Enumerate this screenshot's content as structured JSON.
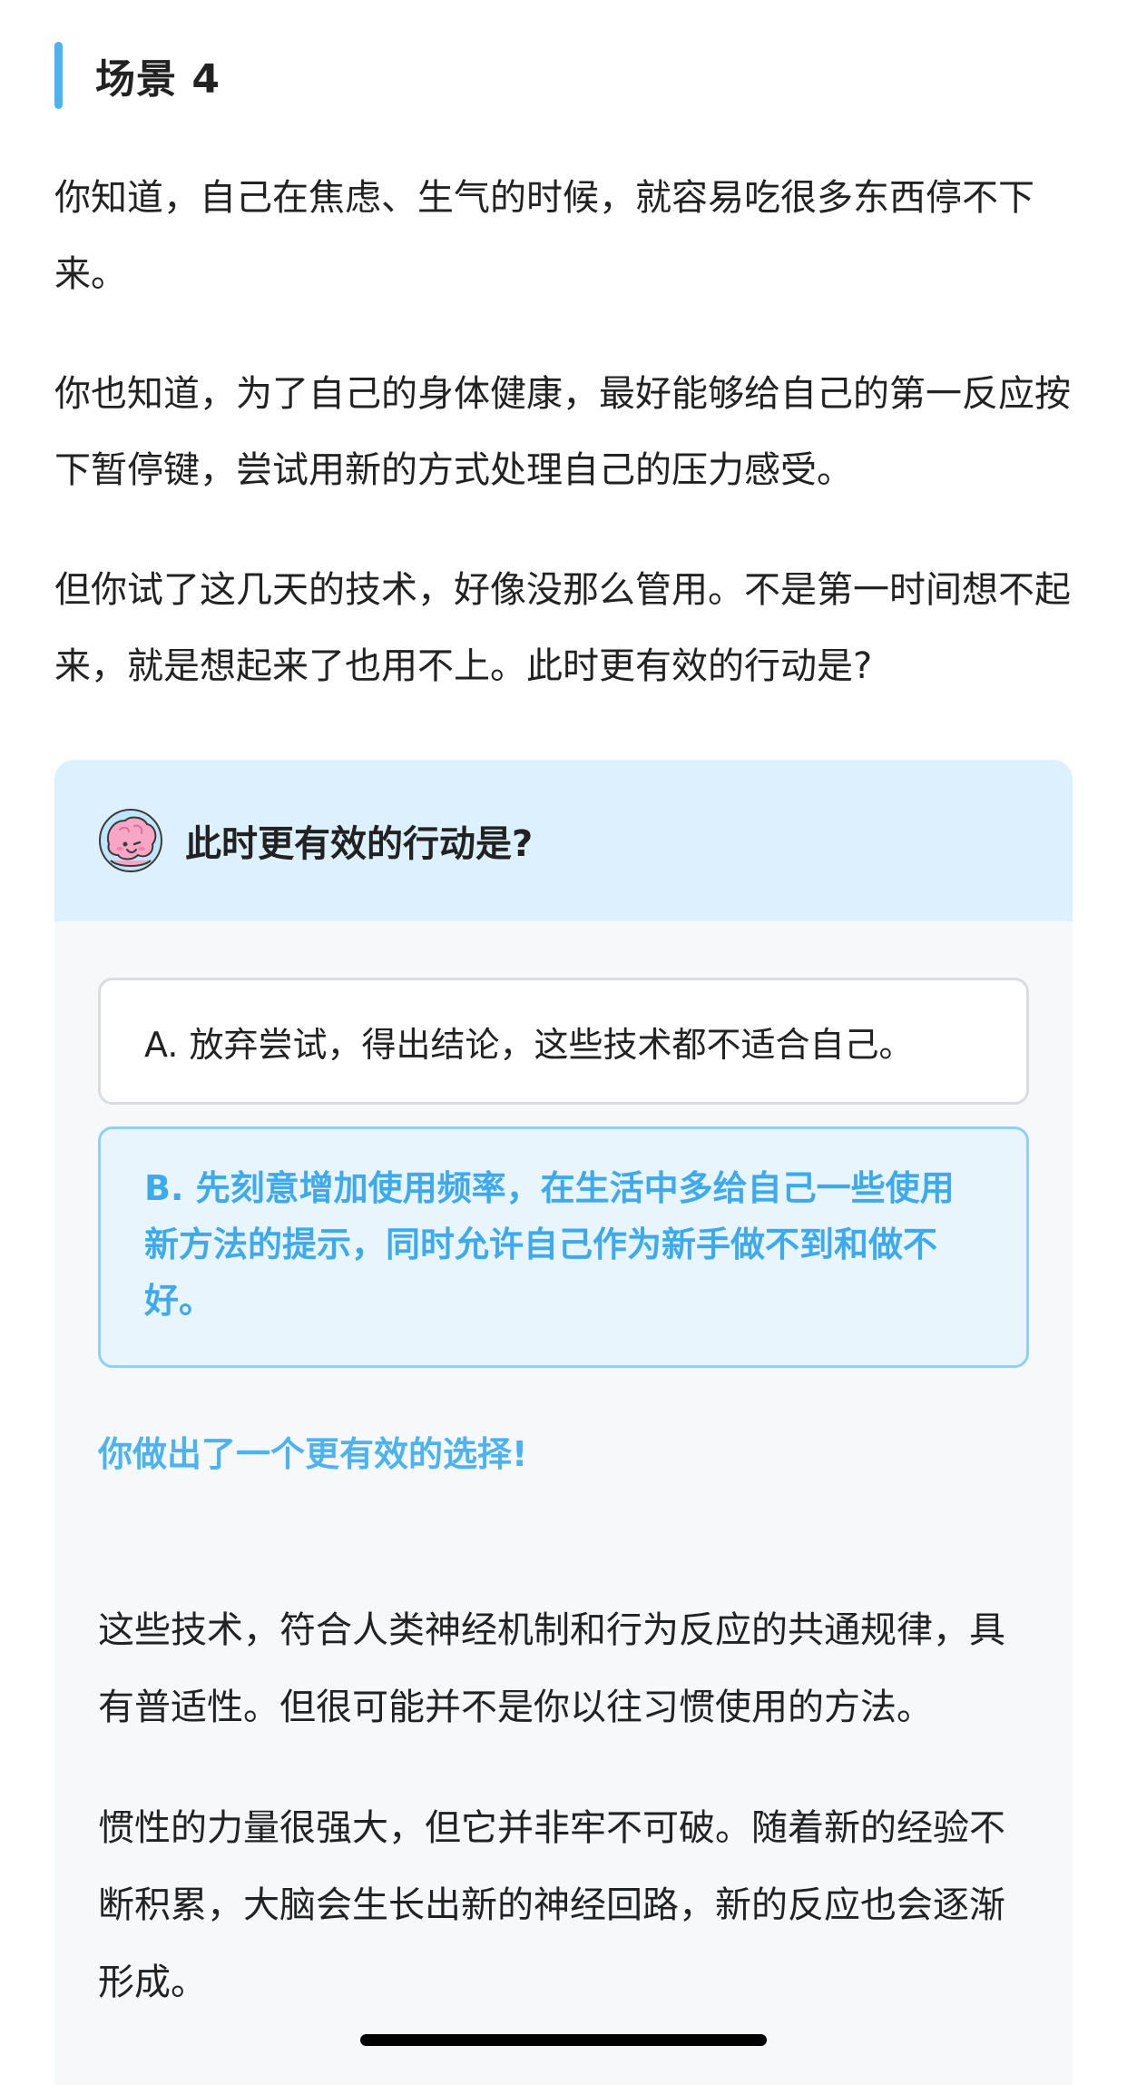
{
  "section": {
    "title": "场景 4"
  },
  "intro": {
    "paragraphs": [
      "你知道，自己在焦虑、生气的时候，就容易吃很多东西停不下来。",
      "你也知道，为了自己的身体健康，最好能够给自己的第一反应按下暂停键，尝试用新的方式处理自己的压力感受。",
      "但你试了这几天的技术，好像没那么管用。不是第一时间想不起来，就是想起来了也用不上。此时更有效的行动是?"
    ]
  },
  "quiz": {
    "question": "此时更有效的行动是?",
    "mascot_icon": "brain-mascot-icon",
    "options": [
      {
        "label": "A. 放弃尝试，得出结论，这些技术都不适合自己。",
        "selected": false
      },
      {
        "label": "B. 先刻意增加使用频率，在生活中多给自己一些使用新方法的提示，同时允许自己作为新手做不到和做不好。",
        "selected": true
      }
    ],
    "feedback": "你做出了一个更有效的选择!",
    "explanation": [
      "这些技术，符合人类神经机制和行为反应的共通规律，具有普适性。但很可能并不是你以往习惯使用的方法。",
      "惯性的力量很强大，但它并非牢不可破。随着新的经验不断积累，大脑会生长出新的神经回路，新的反应也会逐渐形成。"
    ]
  },
  "colors": {
    "accent": "#4db3f0",
    "selected_text": "#3fa9ee",
    "selected_bg": "#e8f5fd",
    "card_header_bg": "#dcf0fd",
    "card_bg": "#f6f8fa"
  }
}
